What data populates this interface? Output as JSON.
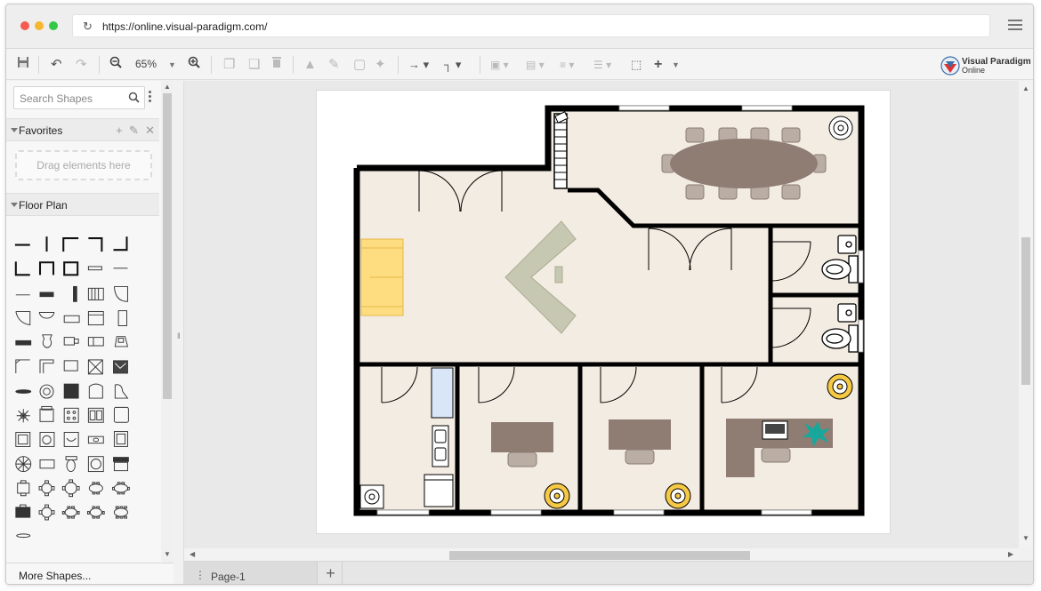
{
  "browser": {
    "url": "https://online.visual-paradigm.com/"
  },
  "toolbar": {
    "zoom": "65%"
  },
  "brand": {
    "name_line1": "Visual Paradigm",
    "name_line2": "Online"
  },
  "sidebar": {
    "search_placeholder": "Search Shapes",
    "favorites_label": "Favorites",
    "drop_hint": "Drag elements here",
    "floorplan_label": "Floor Plan",
    "more_shapes": "More Shapes..."
  },
  "tabs": {
    "page1": "Page-1",
    "add": "+"
  },
  "colors": {
    "floor": "#f3ece2",
    "wall": "#000000",
    "table": "#8f7d74",
    "sofa": "#fedd80",
    "desk_l": "#c6c8b1",
    "sink": "#d8e6f7",
    "plant": "#19a79b",
    "gold": "#f6c944"
  }
}
